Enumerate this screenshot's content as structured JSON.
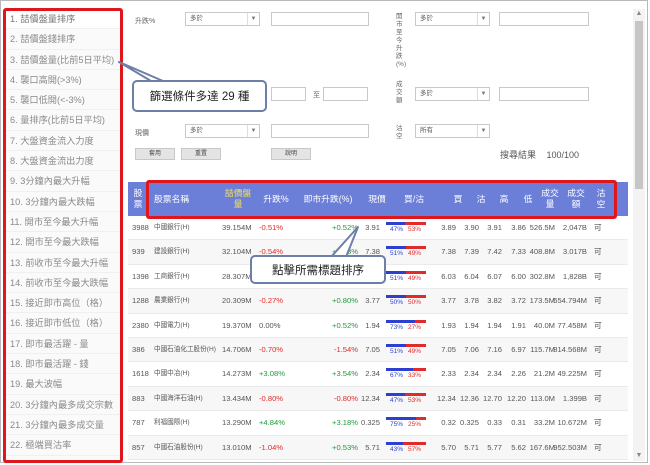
{
  "sidebar": {
    "items": [
      "1. 喆價盤量排序",
      "2. 喆價盤錢排序",
      "3. 喆價盤量(比前5日平均)",
      "4. 襲口高開(>3%)",
      "5. 襲口低開(<-3%)",
      "6. 量排序(比前5日平均)",
      "7. 大盤資金流入力度",
      "8. 大盤資金流出力度",
      "9. 3分鐘內最大升幅",
      "10. 3分鐘內最大跌幅",
      "11. 開市至今最大升幅",
      "12. 開市至今最大跌幅",
      "13. 前收市至今最大升幅",
      "14. 前收市至今最大跌幅",
      "15. 接近即市高位（格）",
      "16. 接近即市低位（格）",
      "17. 即市最活躍 - 量",
      "18. 即市最活躍 - 錢",
      "19. 最大波幅",
      "20. 3分鐘內最多成交宗數",
      "21. 3分鐘內最多成交量",
      "22. 極端買沽率",
      "23. 極端沽買率"
    ]
  },
  "filters": {
    "change_label": "升跌%",
    "change_op": "多於",
    "right_label": "開市至今升跌(%)",
    "right_op": "多於",
    "range_sep": "至",
    "volume_label": "成交額",
    "volume_op": "多於",
    "price_label": "現價",
    "price_op": "多於",
    "market_label": "沽空",
    "market_op": "所有",
    "apply_button": "套用",
    "reset_button": "重置",
    "help_button": "說明",
    "result_label": "搜尋結果",
    "result_value": "100/100"
  },
  "callouts": {
    "conditions": "篩選條件多達 29 種",
    "sort": "點擊所需標題排序"
  },
  "table": {
    "headers": {
      "code": "股票",
      "name": "股票名稱",
      "abnormal": "喆價盤量",
      "change": "升跌%",
      "today_change": "即市升跌(%)",
      "price": "現價",
      "buy_sell": "買/沽",
      "bid": "買",
      "ask": "沽",
      "high": "高",
      "low": "低",
      "volume": "成交量",
      "turnover": "成交額",
      "short": "沽空"
    },
    "rows": [
      {
        "code": "3988",
        "name": "中國銀行(H)",
        "abnormal": "39.154M",
        "change": "-0.51%",
        "today": "+0.52%",
        "price": "3.91",
        "buy": "47%",
        "sell": "53%",
        "bid": "3.89",
        "ask": "3.90",
        "high": "3.91",
        "low": "3.86",
        "vol": "526.5M",
        "amt": "2,047B",
        "short": "可"
      },
      {
        "code": "939",
        "name": "建設銀行(H)",
        "abnormal": "32.104M",
        "change": "-0.54%",
        "today": "+0.53%",
        "price": "7.38",
        "buy": "51%",
        "sell": "49%",
        "bid": "7.38",
        "ask": "7.39",
        "high": "7.42",
        "low": "7.33",
        "vol": "408.8M",
        "amt": "3.017B",
        "short": "可"
      },
      {
        "code": "1398",
        "name": "工商銀行(H)",
        "abnormal": "28.307M",
        "change": "-0.47%",
        "today": "+0.51%",
        "price": "6.04",
        "buy": "51%",
        "sell": "49%",
        "bid": "6.03",
        "ask": "6.04",
        "high": "6.07",
        "low": "6.00",
        "vol": "302.8M",
        "amt": "1,828B",
        "short": "可"
      },
      {
        "code": "1288",
        "name": "農業銀行(H)",
        "abnormal": "20.309M",
        "change": "-0.27%",
        "today": "+0.80%",
        "price": "3.77",
        "buy": "50%",
        "sell": "50%",
        "bid": "3.77",
        "ask": "3.78",
        "high": "3.82",
        "low": "3.72",
        "vol": "173.5M",
        "amt": "654.794M",
        "short": "可"
      },
      {
        "code": "2380",
        "name": "中國電力(H)",
        "abnormal": "19.370M",
        "change": "0.00%",
        "today": "+0.52%",
        "price": "1.94",
        "buy": "73%",
        "sell": "27%",
        "bid": "1.93",
        "ask": "1.94",
        "high": "1.94",
        "low": "1.91",
        "vol": "40.0M",
        "amt": "77.458M",
        "short": "可"
      },
      {
        "code": "386",
        "name": "中國石油化工股份(H)",
        "abnormal": "14.706M",
        "change": "-0.70%",
        "today": "-1.54%",
        "price": "7.05",
        "buy": "51%",
        "sell": "49%",
        "bid": "7.05",
        "ask": "7.06",
        "high": "7.16",
        "low": "6.97",
        "vol": "115.7M",
        "amt": "814.568M",
        "short": "可"
      },
      {
        "code": "1618",
        "name": "中國中冶(H)",
        "abnormal": "14.273M",
        "change": "+3.08%",
        "today": "+3.54%",
        "price": "2.34",
        "buy": "67%",
        "sell": "33%",
        "bid": "2.33",
        "ask": "2.34",
        "high": "2.34",
        "low": "2.26",
        "vol": "21.2M",
        "amt": "49.225M",
        "short": "可"
      },
      {
        "code": "883",
        "name": "中國海洋石油(H)",
        "abnormal": "13.434M",
        "change": "-0.80%",
        "today": "-0.80%",
        "price": "12.34",
        "buy": "47%",
        "sell": "53%",
        "bid": "12.34",
        "ask": "12.36",
        "high": "12.70",
        "low": "12.20",
        "vol": "113.0M",
        "amt": "1.399B",
        "short": "可"
      },
      {
        "code": "787",
        "name": "利福國際(H)",
        "abnormal": "13.290M",
        "change": "+4.84%",
        "today": "+3.18%",
        "price": "0.325",
        "buy": "75%",
        "sell": "25%",
        "bid": "0.32",
        "ask": "0.325",
        "high": "0.33",
        "low": "0.31",
        "vol": "33.2M",
        "amt": "10.672M",
        "short": "可"
      },
      {
        "code": "857",
        "name": "中國石油股份(H)",
        "abnormal": "13.010M",
        "change": "-1.04%",
        "today": "+0.53%",
        "price": "5.71",
        "buy": "43%",
        "sell": "57%",
        "bid": "5.70",
        "ask": "5.71",
        "high": "5.77",
        "low": "5.62",
        "vol": "167.6M",
        "amt": "952.503M",
        "short": "可"
      }
    ]
  },
  "colors": {
    "header_bg": "#6c7fd8",
    "highlight_box": "#e0161d",
    "up": "#1f9a3a",
    "down": "#e22a2a"
  }
}
